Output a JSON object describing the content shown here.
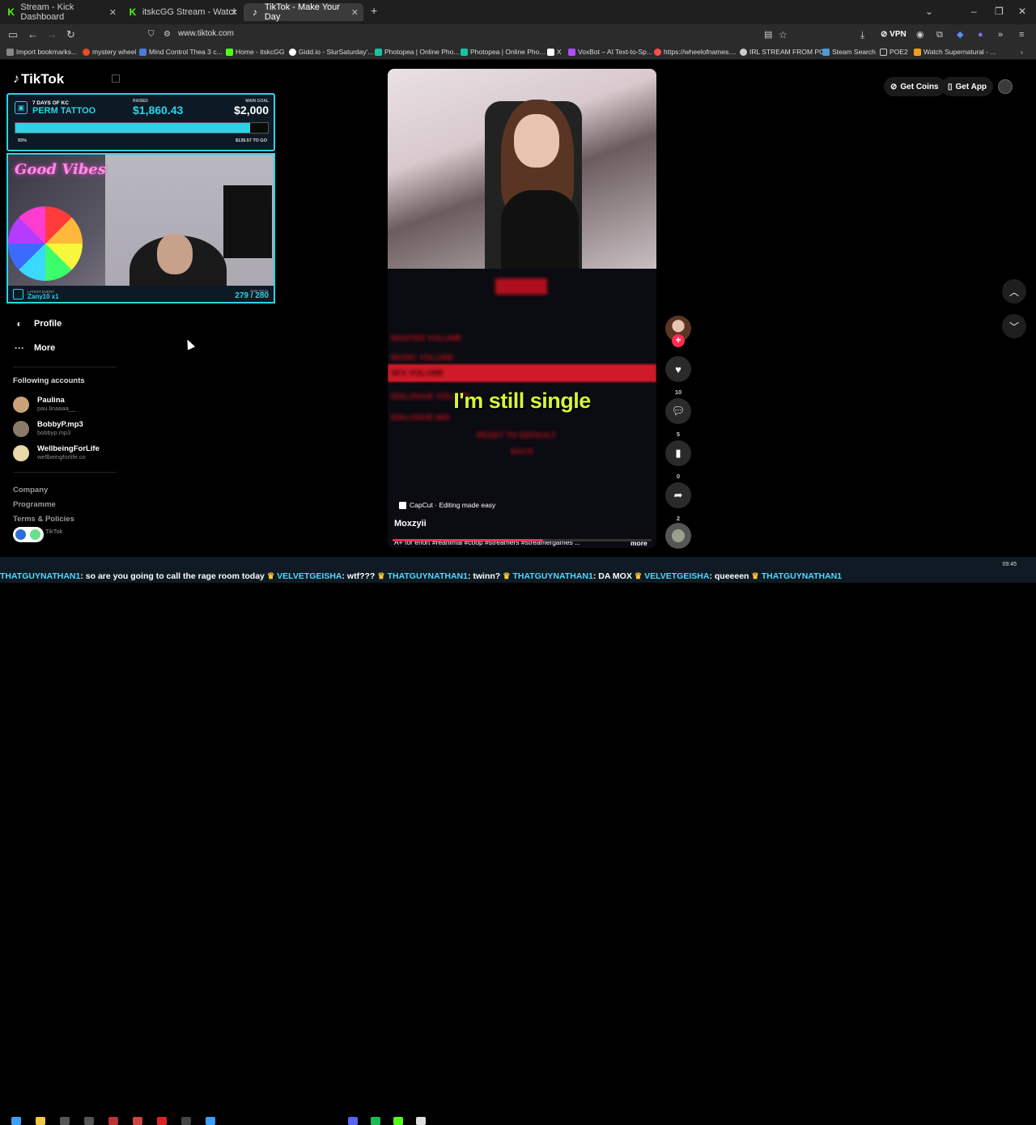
{
  "browser": {
    "tabs": [
      {
        "title": "Stream - Kick Dashboard",
        "icon": "kick-icon",
        "active": false
      },
      {
        "title": "itskcGG Stream - Watch Live on",
        "icon": "kick-icon",
        "active": false
      },
      {
        "title": "TikTok - Make Your Day",
        "icon": "tiktok-icon",
        "active": true
      }
    ],
    "url": "www.tiktok.com",
    "vpn_label": "VPN",
    "bookmarks": [
      {
        "label": "Import bookmarks...",
        "color": "#888888"
      },
      {
        "label": "mystery wheel",
        "color": "#e44d26"
      },
      {
        "label": "Mind Control Thea 3 c...",
        "color": "#4a7bd6"
      },
      {
        "label": "Home - itskcGG",
        "color": "#53fc18"
      },
      {
        "label": "Gidd.io - SlurSaturday'...",
        "color": "#ffffff"
      },
      {
        "label": "Photopea | Online Pho...",
        "color": "#19c3a2"
      },
      {
        "label": "Photopea | Online Pho...",
        "color": "#19c3a2"
      },
      {
        "label": "X",
        "color": "#ffffff"
      },
      {
        "label": "VoxBot – AI Text-to-Sp...",
        "color": "#b14cff"
      },
      {
        "label": "https://wheelofnames....",
        "color": "#ff4c4c"
      },
      {
        "label": "IRL STREAM FROM PC",
        "color": "#cccccc"
      },
      {
        "label": "Steam Search",
        "color": "#4a9ad6"
      },
      {
        "label": "POE2",
        "color": "#cccccc"
      },
      {
        "label": "Watch Supernatural - ...",
        "color": "#f29c1f"
      }
    ]
  },
  "sidebar": {
    "logo": "TikTok",
    "nav": [
      {
        "label": "Profile",
        "icon": "profile-icon"
      },
      {
        "label": "More",
        "icon": "more-icon"
      }
    ],
    "following_title": "Following accounts",
    "following": [
      {
        "name": "Paulina",
        "handle": "pau.linaaaa__",
        "color": "#c9a27a"
      },
      {
        "name": "BobbyP.mp3",
        "handle": "bobbyp.mp3",
        "color": "#8a7a6a"
      },
      {
        "name": "WellbeingForLife",
        "handle": "wellbeingforlife.co",
        "color": "#e8d9a8"
      }
    ],
    "footer_links": [
      "Company",
      "Programme",
      "Terms & Policies"
    ],
    "copyright": "TikTok"
  },
  "overlay": {
    "title_small": "7 DAYS OF KC",
    "title_big": "PERM TATTOO",
    "raised_label": "RAISED",
    "raised_value": "$1,860.43",
    "goal_label": "MAIN GOAL",
    "goal_value": "$2,000",
    "progress_pct": 93,
    "progress_text": "93%",
    "to_go": "$139.57 TO GO",
    "webcam_sign": "Good Vibes",
    "latest_event_label": "LATEST EVENT",
    "latest_event": "Zany10 x1",
    "sub_goal_label": "SUB GOAL",
    "sub_goal_value": "279 / 280"
  },
  "video": {
    "caption": "I'm still single",
    "capcut_label": "CapCut · Editing made easy",
    "author": "Moxzyii",
    "description": "A+ for effort #reanimal #coop #streamers #streamergames ...",
    "more_label": "more",
    "progress": 0.58,
    "blurred_menu": [
      "MASTER VOLUME",
      "MUSIC VOLUME",
      "SFX VOLUME",
      "DIALOGUE VOLUME",
      "DIALOGUE MIX",
      "RESET TO DEFAULT",
      "BACK"
    ]
  },
  "actions": {
    "likes": "10",
    "comments": "5",
    "saves": "0",
    "shares": "2"
  },
  "header": {
    "get_coins": "Get Coins",
    "get_app": "Get App"
  },
  "ticker": [
    {
      "name": "THATGUYNATHAN1",
      "text": ": so are you going to call the rage room today"
    },
    {
      "name": "VELVETGEISHA",
      "text": ": wtf???"
    },
    {
      "name": "THATGUYNATHAN1",
      "text": ": twinn?"
    },
    {
      "name": "THATGUYNATHAN1",
      "text": ": DA MOX"
    },
    {
      "name": "VELVETGEISHA",
      "text": ": queeeen"
    },
    {
      "name": "THATGUYNATHAN1",
      "text": ""
    }
  ],
  "clock": "09:45"
}
